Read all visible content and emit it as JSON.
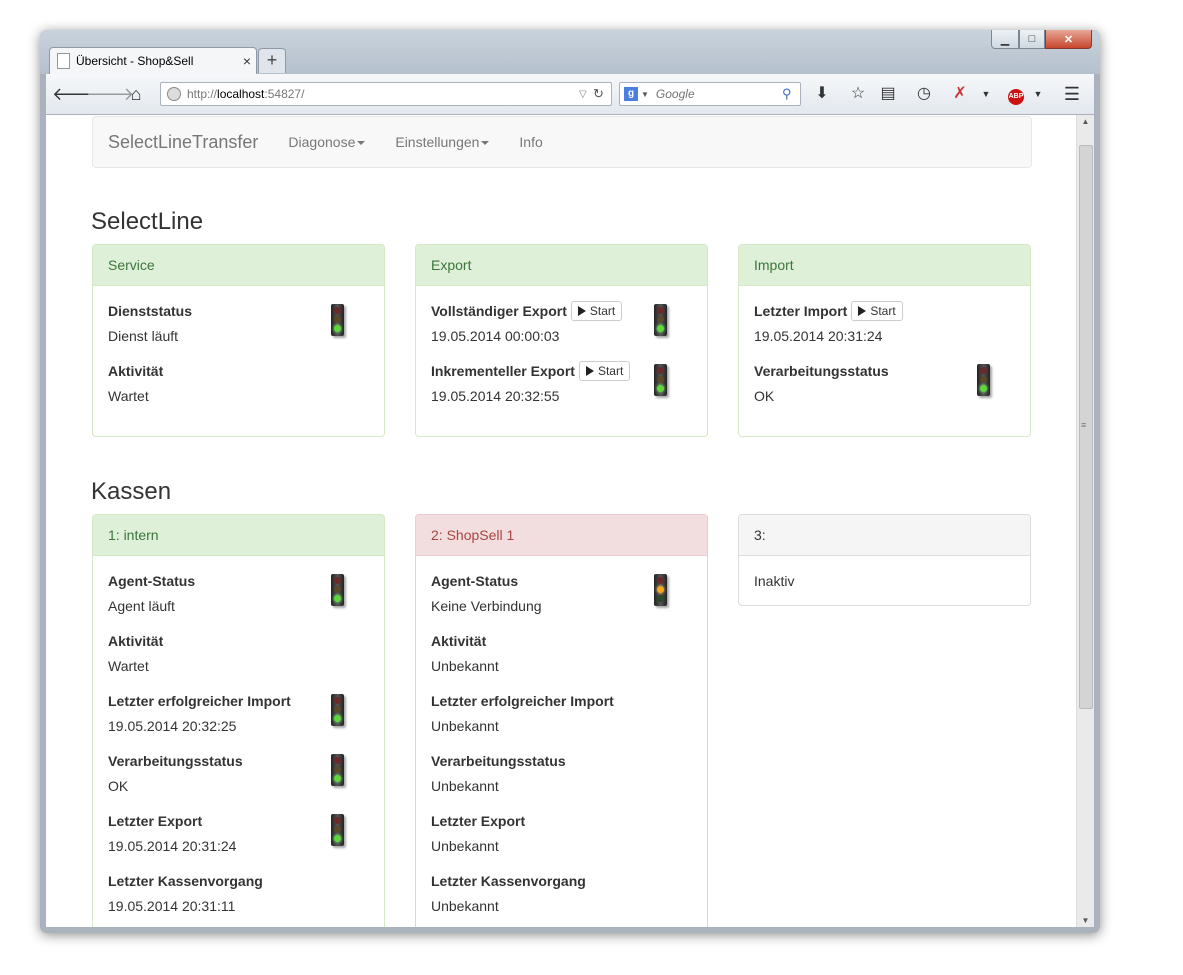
{
  "browser": {
    "tab_title": "Übersicht - Shop&Sell",
    "tab_close": "×",
    "new_tab": "+",
    "url_prefix": "http://",
    "url_host": "localhost",
    "url_rest": ":54827/",
    "search_placeholder": "Google",
    "search_engine_letter": "g"
  },
  "app": {
    "brand": "SelectLineTransfer",
    "nav": [
      {
        "label": "Diagonose"
      },
      {
        "label": "Einstellungen"
      },
      {
        "label": "Info"
      }
    ]
  },
  "selectline": {
    "heading": "SelectLine",
    "service": {
      "title": "Service",
      "items": [
        {
          "label": "Dienststatus",
          "value": "Dienst läuft",
          "light": "green"
        },
        {
          "label": "Aktivität",
          "value": "Wartet"
        }
      ]
    },
    "export": {
      "title": "Export",
      "items": [
        {
          "label": "Vollständiger Export",
          "button": "Start",
          "value": "19.05.2014 00:00:03",
          "light": "green"
        },
        {
          "label": "Inkrementeller Export",
          "button": "Start",
          "value": "19.05.2014 20:32:55",
          "light": "green"
        }
      ]
    },
    "import": {
      "title": "Import",
      "items": [
        {
          "label": "Letzter Import",
          "button": "Start",
          "value": "19.05.2014 20:31:24"
        },
        {
          "label": "Verarbeitungsstatus",
          "value": "OK",
          "light": "green"
        }
      ]
    }
  },
  "kassen": {
    "heading": "Kassen",
    "k1": {
      "title": "1: intern",
      "items": [
        {
          "label": "Agent-Status",
          "value": "Agent läuft",
          "light": "green"
        },
        {
          "label": "Aktivität",
          "value": "Wartet"
        },
        {
          "label": "Letzter erfolgreicher Import",
          "value": "19.05.2014 20:32:25",
          "light": "green"
        },
        {
          "label": "Verarbeitungsstatus",
          "value": "OK",
          "light": "green"
        },
        {
          "label": "Letzter Export",
          "value": "19.05.2014 20:31:24",
          "light": "green"
        },
        {
          "label": "Letzter Kassenvorgang",
          "value": "19.05.2014 20:31:11"
        }
      ]
    },
    "k2": {
      "title": "2: ShopSell 1",
      "items": [
        {
          "label": "Agent-Status",
          "value": "Keine Verbindung",
          "light": "yellow"
        },
        {
          "label": "Aktivität",
          "value": "Unbekannt"
        },
        {
          "label": "Letzter erfolgreicher Import",
          "value": "Unbekannt"
        },
        {
          "label": "Verarbeitungsstatus",
          "value": "Unbekannt"
        },
        {
          "label": "Letzter Export",
          "value": "Unbekannt"
        },
        {
          "label": "Letzter Kassenvorgang",
          "value": "Unbekannt"
        }
      ]
    },
    "k3": {
      "title": "3:",
      "text": "Inaktiv"
    }
  }
}
